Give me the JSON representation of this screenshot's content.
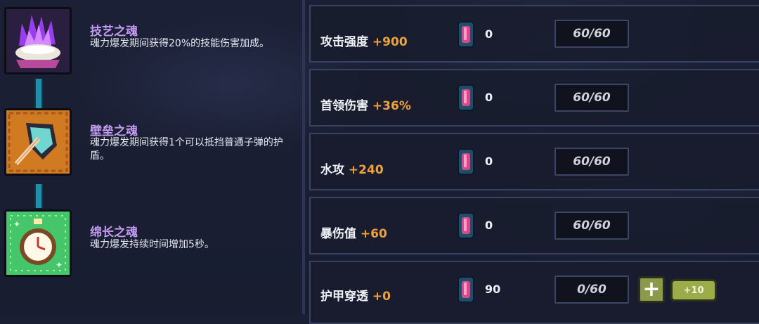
{
  "souls": [
    {
      "name": "技艺之魂",
      "desc": "魂力爆发期间获得20%的技能伤害加成。",
      "icon": "purple-flame-orb-icon"
    },
    {
      "name": "壁垒之魂",
      "desc": "魂力爆发期间获得1个可以抵挡普通子弹的护盾。",
      "icon": "shield-axe-icon"
    },
    {
      "name": "绵长之魂",
      "desc": "魂力爆发持续时间增加5秒。",
      "icon": "stopwatch-icon"
    }
  ],
  "stats": [
    {
      "label": "攻击强度",
      "bonus": "+900",
      "gems": "0",
      "cap": "60/60"
    },
    {
      "label": "首领伤害",
      "bonus": "+36%",
      "gems": "0",
      "cap": "60/60"
    },
    {
      "label": "水攻",
      "bonus": "+240",
      "gems": "0",
      "cap": "60/60"
    },
    {
      "label": "暴伤值",
      "bonus": "+60",
      "gems": "0",
      "cap": "60/60"
    },
    {
      "label": "护甲穿透",
      "bonus": "+0",
      "gems": "90",
      "cap": "0/60"
    }
  ],
  "buttons": {
    "plus": "+",
    "plus10": "+10"
  },
  "colors": {
    "soul_title": "#c39bf0",
    "bonus": "#f0a23a",
    "button_green": "#9cac48"
  }
}
